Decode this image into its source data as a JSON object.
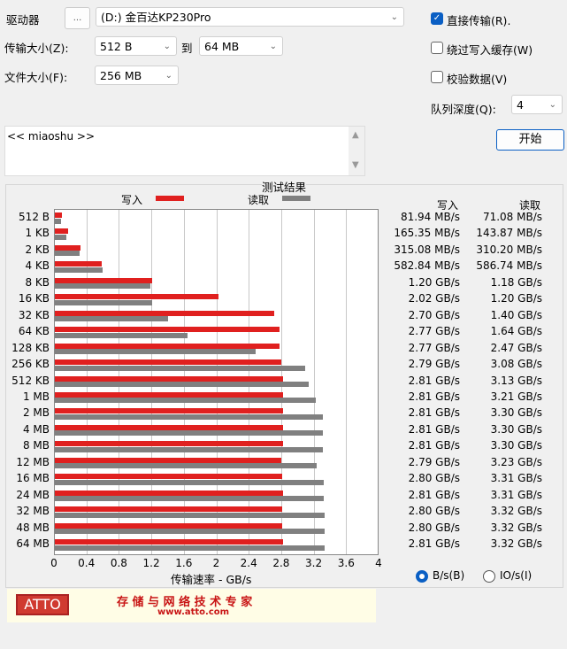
{
  "controls": {
    "drive_label": "驱动器",
    "browse_label": "...",
    "drive_value": "(D:) 金百达KP230Pro",
    "transfer_label": "传输大小(Z):",
    "transfer_from": "512 B",
    "to_label": "到",
    "transfer_to": "64 MB",
    "file_size_label": "文件大小(F):",
    "file_size": "256 MB",
    "direct_io_label": "直接传输(R).",
    "direct_io_checked": true,
    "bypass_cache_label": "绕过写入缓存(W)",
    "bypass_cache_checked": false,
    "verify_label": "校验数据(V)",
    "verify_checked": false,
    "queue_label": "队列深度(Q):",
    "queue_value": "4",
    "start_label": "开始",
    "description": "<< miaoshu >>"
  },
  "results": {
    "title": "测试结果",
    "legend_write": "写入",
    "legend_read": "读取",
    "col_write": "写入",
    "col_read": "读取",
    "xlabel": "传输速率 - GB/s",
    "unit_bs": "B/s(B)",
    "unit_ios": "IO/s(I)",
    "unit_selected": "B/s",
    "write_text": [
      "81.94 MB/s",
      "165.35 MB/s",
      "315.08 MB/s",
      "582.84 MB/s",
      "1.20 GB/s",
      "2.02 GB/s",
      "2.70 GB/s",
      "2.77 GB/s",
      "2.77 GB/s",
      "2.79 GB/s",
      "2.81 GB/s",
      "2.81 GB/s",
      "2.81 GB/s",
      "2.81 GB/s",
      "2.81 GB/s",
      "2.79 GB/s",
      "2.80 GB/s",
      "2.81 GB/s",
      "2.80 GB/s",
      "2.80 GB/s",
      "2.81 GB/s"
    ],
    "read_text": [
      "71.08 MB/s",
      "143.87 MB/s",
      "310.20 MB/s",
      "586.74 MB/s",
      "1.18 GB/s",
      "1.20 GB/s",
      "1.40 GB/s",
      "1.64 GB/s",
      "2.47 GB/s",
      "3.08 GB/s",
      "3.13 GB/s",
      "3.21 GB/s",
      "3.30 GB/s",
      "3.30 GB/s",
      "3.30 GB/s",
      "3.23 GB/s",
      "3.31 GB/s",
      "3.31 GB/s",
      "3.32 GB/s",
      "3.32 GB/s",
      "3.32 GB/s"
    ]
  },
  "chart_data": {
    "type": "bar",
    "orientation": "horizontal",
    "categories": [
      "512 B",
      "1 KB",
      "2 KB",
      "4 KB",
      "8 KB",
      "16 KB",
      "32 KB",
      "64 KB",
      "128 KB",
      "256 KB",
      "512 KB",
      "1 MB",
      "2 MB",
      "4 MB",
      "8 MB",
      "12 MB",
      "16 MB",
      "24 MB",
      "32 MB",
      "48 MB",
      "64 MB"
    ],
    "series": [
      {
        "name": "写入",
        "color": "#e0201f",
        "values": [
          0.08194,
          0.16535,
          0.31508,
          0.58284,
          1.2,
          2.02,
          2.7,
          2.77,
          2.77,
          2.79,
          2.81,
          2.81,
          2.81,
          2.81,
          2.81,
          2.79,
          2.8,
          2.81,
          2.8,
          2.8,
          2.81
        ]
      },
      {
        "name": "读取",
        "color": "#808080",
        "values": [
          0.07108,
          0.14387,
          0.3102,
          0.58674,
          1.18,
          1.2,
          1.4,
          1.64,
          2.47,
          3.08,
          3.13,
          3.21,
          3.3,
          3.3,
          3.3,
          3.23,
          3.31,
          3.31,
          3.32,
          3.32,
          3.32
        ]
      }
    ],
    "xlim": [
      0,
      4
    ],
    "xticks": [
      "0",
      "0.4",
      "0.8",
      "1.2",
      "1.6",
      "2",
      "2.4",
      "2.8",
      "3.2",
      "3.6",
      "4"
    ],
    "xlabel": "传输速率 - GB/s",
    "title": "测试结果",
    "grid": true,
    "legend": "top"
  },
  "banner": {
    "logo": "ATTO",
    "slogan": "存 储 与 网 络 技 术 专 家",
    "url": "www.atto.com"
  }
}
